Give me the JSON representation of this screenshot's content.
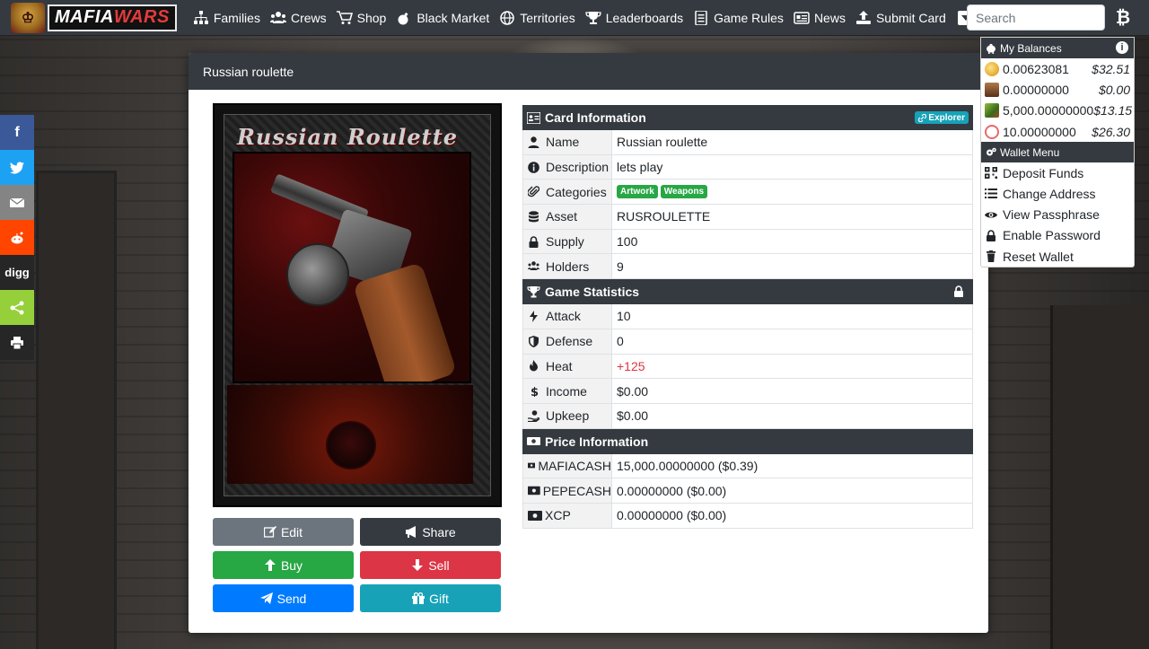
{
  "navbar": {
    "brand": {
      "part1": "MAFIA",
      "part2": "WARS"
    },
    "items": [
      {
        "label": "Families",
        "icon": "sitemap-icon"
      },
      {
        "label": "Crews",
        "icon": "users-icon"
      },
      {
        "label": "Shop",
        "icon": "cart-icon"
      },
      {
        "label": "Black Market",
        "icon": "bomb-icon"
      },
      {
        "label": "Territories",
        "icon": "globe-icon"
      },
      {
        "label": "Leaderboards",
        "icon": "trophy-icon"
      },
      {
        "label": "Game Rules",
        "icon": "list-icon"
      },
      {
        "label": "News",
        "icon": "newspaper-icon"
      },
      {
        "label": "Submit Card",
        "icon": "upload-icon"
      }
    ],
    "search_placeholder": "Search",
    "wallet_symbol": "₿"
  },
  "share_bar": {
    "items": [
      {
        "name": "facebook",
        "label": "f",
        "color": "#3b5998"
      },
      {
        "name": "twitter",
        "label": "",
        "color": "#1da1f2"
      },
      {
        "name": "email",
        "label": "",
        "color": "#848484"
      },
      {
        "name": "reddit",
        "label": "",
        "color": "#ff4500"
      },
      {
        "name": "digg",
        "label": "digg",
        "color": "#262626"
      },
      {
        "name": "sharethis",
        "label": "",
        "color": "#95d03a"
      },
      {
        "name": "print",
        "label": "",
        "color": "#262626"
      }
    ]
  },
  "modal": {
    "title": "Russian roulette",
    "card_title_art": "Russian Roulette",
    "buttons": {
      "edit": "Edit",
      "share": "Share",
      "buy": "Buy",
      "sell": "Sell",
      "send": "Send",
      "gift": "Gift"
    },
    "card_info": {
      "heading": "Card Information",
      "explorer_label": "Explorer",
      "rows": {
        "name": {
          "label": "Name",
          "value": "Russian roulette"
        },
        "description": {
          "label": "Description",
          "value": "lets play"
        },
        "categories": {
          "label": "Categories",
          "tags": [
            "Artwork",
            "Weapons"
          ]
        },
        "asset": {
          "label": "Asset",
          "value": "RUSROULETTE"
        },
        "supply": {
          "label": "Supply",
          "value": "100"
        },
        "holders": {
          "label": "Holders",
          "value": "9"
        }
      }
    },
    "game_stats": {
      "heading": "Game Statistics",
      "rows": {
        "attack": {
          "label": "Attack",
          "value": "10"
        },
        "defense": {
          "label": "Defense",
          "value": "0"
        },
        "heat": {
          "label": "Heat",
          "value": "+125"
        },
        "income": {
          "label": "Income",
          "value": "$0.00"
        },
        "upkeep": {
          "label": "Upkeep",
          "value": "$0.00"
        }
      }
    },
    "price_info": {
      "heading": "Price Information",
      "rows": {
        "mafiacash": {
          "label": "MAFIACASH",
          "value": "15,000.00000000 ($0.39)"
        },
        "pepecash": {
          "label": "PEPECASH",
          "value": "0.00000000 ($0.00)"
        },
        "xcp": {
          "label": "XCP",
          "value": "0.00000000 ($0.00)"
        }
      }
    }
  },
  "balances": {
    "heading": "My Balances",
    "info_symbol": "i",
    "items": [
      {
        "amount": "0.00623081",
        "usd": "$32.51",
        "coin_color": "#e8b33a"
      },
      {
        "amount": "0.00000000",
        "usd": "$0.00",
        "coin_color": "#8a5a3a"
      },
      {
        "amount": "5,000.00000000",
        "usd": "$13.15",
        "coin_color": "#5a8a2a"
      },
      {
        "amount": "10.00000000",
        "usd": "$26.30",
        "coin_color": "#e86a6a"
      }
    ],
    "menu_heading": "Wallet Menu",
    "menu": [
      {
        "label": "Deposit Funds",
        "icon": "qrcode-icon"
      },
      {
        "label": "Change Address",
        "icon": "list-icon"
      },
      {
        "label": "View Passphrase",
        "icon": "eye-icon"
      },
      {
        "label": "Enable Password",
        "icon": "lock-icon"
      },
      {
        "label": "Reset Wallet",
        "icon": "trash-icon"
      }
    ]
  },
  "colors": {
    "navbar": "#343a40",
    "edit": "#6c757d",
    "share": "#343a40",
    "buy": "#28a745",
    "sell": "#dc3545",
    "send": "#007bff",
    "gift": "#17a2b8",
    "heat": "#dc3545",
    "tag": "#28a745",
    "explorer": "#17a2b8"
  }
}
